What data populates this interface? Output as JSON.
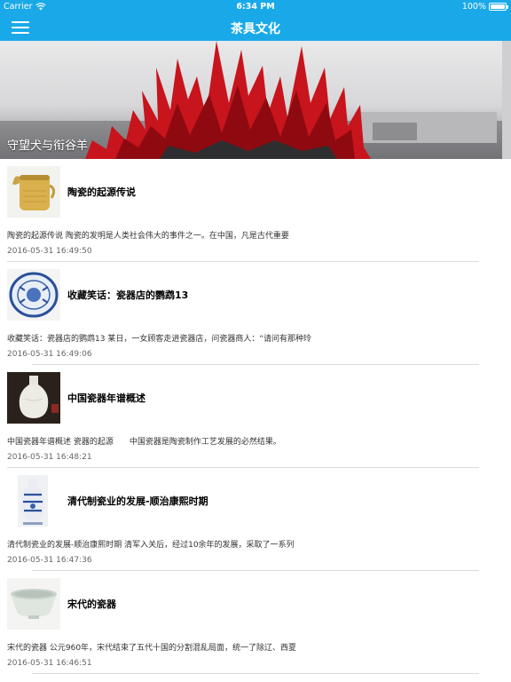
{
  "status_bar": {
    "carrier": "Carrier",
    "time": "6:34 PM",
    "battery": "100%"
  },
  "nav": {
    "title": "茶具文化"
  },
  "banner": {
    "caption": "守望犬与衔谷羊"
  },
  "articles": [
    {
      "title": "陶瓷的起源传说",
      "summary": "陶瓷的起源传说 陶瓷的发明是人类社会伟大的事件之一。在中国，凡是古代重要",
      "date": "2016-05-31 16:49:50"
    },
    {
      "title": "收藏笑话：瓷器店的鹦鹉13",
      "summary": "收藏笑话：瓷器店的鹦鹉13 某日，一女顾客走进瓷器店，问瓷器商人：“请问有那种玲",
      "date": "2016-05-31 16:49:06"
    },
    {
      "title": "中国瓷器年谱概述",
      "summary": "中国瓷器年谱概述 瓷器的起源　　中国瓷器是陶瓷制作工艺发展的必然结果。",
      "date": "2016-05-31 16:48:21"
    },
    {
      "title": "清代制瓷业的发展-顺治康熙时期",
      "summary": "清代制瓷业的发展-顺治康熙时期 清军入关后，经过10余年的发展，采取了一系列",
      "date": "2016-05-31 16:47:36"
    },
    {
      "title": "宋代的瓷器",
      "summary": "宋代的瓷器 公元960年，宋代结束了五代十国的分割混乱局面，统一了除辽、西夏",
      "date": "2016-05-31 16:46:51"
    }
  ],
  "colors": {
    "accent": "#19a9e8",
    "separator": "#dcdcdc"
  }
}
